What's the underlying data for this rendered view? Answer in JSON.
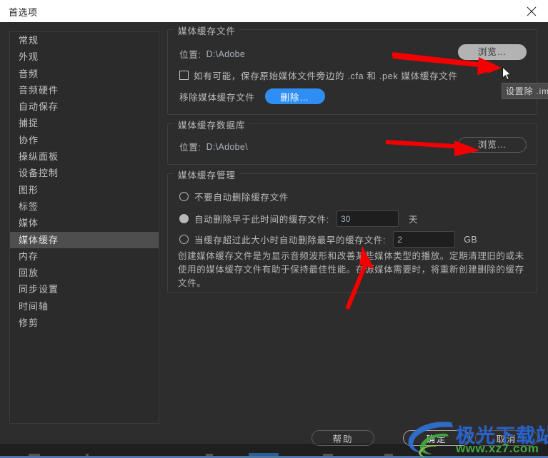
{
  "window": {
    "title": "首选项",
    "close_icon": "close-icon"
  },
  "sidebar": {
    "items": [
      {
        "label": "常规",
        "selected": false
      },
      {
        "label": "外观",
        "selected": false
      },
      {
        "label": "音频",
        "selected": false
      },
      {
        "label": "音频硬件",
        "selected": false
      },
      {
        "label": "自动保存",
        "selected": false
      },
      {
        "label": "捕捉",
        "selected": false
      },
      {
        "label": "协作",
        "selected": false
      },
      {
        "label": "操纵面板",
        "selected": false
      },
      {
        "label": "设备控制",
        "selected": false
      },
      {
        "label": "图形",
        "selected": false
      },
      {
        "label": "标签",
        "selected": false
      },
      {
        "label": "媒体",
        "selected": false
      },
      {
        "label": "媒体缓存",
        "selected": true
      },
      {
        "label": "内存",
        "selected": false
      },
      {
        "label": "回放",
        "selected": false
      },
      {
        "label": "同步设置",
        "selected": false
      },
      {
        "label": "时间轴",
        "selected": false
      },
      {
        "label": "修剪",
        "selected": false
      }
    ]
  },
  "media_cache_files": {
    "group_title": "媒体缓存文件",
    "location_label": "位置:",
    "location_value": "D:\\Adobe",
    "browse_label": "浏览…",
    "checkbox_label": "如有可能，保存原始媒体文件旁边的 .cfa 和 .pek 媒体缓存文件",
    "checkbox_checked": false,
    "remove_label": "移除媒体缓存文件",
    "delete_button_label": "删除…"
  },
  "media_cache_database": {
    "group_title": "媒体缓存数据库",
    "location_label": "位置:",
    "location_value": "D:\\Adobe\\",
    "browse_label": "浏览…"
  },
  "media_cache_management": {
    "group_title": "媒体缓存管理",
    "options": [
      {
        "label": "不要自动删除缓存文件",
        "selected": false,
        "input": null,
        "unit": null
      },
      {
        "label": "自动删除早于此时间的缓存文件:",
        "selected": true,
        "input": "30",
        "unit": "天"
      },
      {
        "label": "当缓存超过此大小时自动删除最早的缓存文件:",
        "selected": false,
        "input": "2",
        "unit": "GB"
      }
    ],
    "description": "创建媒体缓存文件是为显示音频波形和改善某些媒体类型的播放。定期清理旧的或未使用的媒体缓存文件有助于保持最佳性能。在源媒体需要时，将重新创建删除的缓存文件。"
  },
  "tooltip": {
    "text": "设置除 .im"
  },
  "footer": {
    "help_label": "帮助",
    "ok_label": "确定",
    "cancel_label": "取消"
  },
  "watermark": {
    "main": "极光下载站",
    "sub": "www.xz7.com"
  },
  "colors": {
    "accent_blue": "#2f8ef4",
    "dialog_bg": "#2d2d2d",
    "titlebar_bg": "#ffffff",
    "selection": "#4e4e4e",
    "annotation_red": "#f40000",
    "watermark_blue": "#2a62c8",
    "watermark_green": "#3faa3f"
  }
}
